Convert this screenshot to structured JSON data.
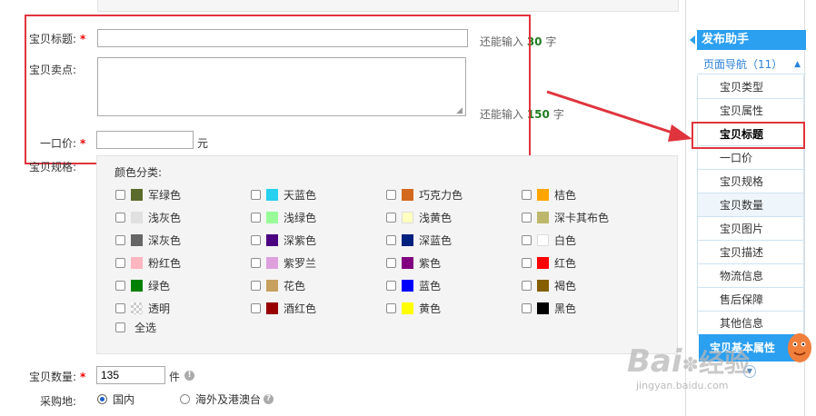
{
  "form": {
    "title_label": "宝贝标题:",
    "title_required": "*",
    "title_value": "",
    "title_hint_prefix": "还能输入 ",
    "title_hint_count": "30",
    "title_hint_suffix": " 字",
    "selling_label": "宝贝卖点:",
    "selling_value": "",
    "selling_hint_prefix": "还能输入 ",
    "selling_hint_count": "150",
    "selling_hint_suffix": " 字",
    "price_label": "一口价:",
    "price_required": "*",
    "price_value": "",
    "price_unit": "元",
    "spec_label": "宝贝规格:",
    "color_category_label": "颜色分类:",
    "quantity_label": "宝贝数量:",
    "quantity_required": "*",
    "quantity_value": "135",
    "quantity_unit": "件",
    "purchase_label": "采购地:",
    "purchase_options": [
      "国内",
      "海外及港澳台"
    ]
  },
  "colors": [
    {
      "label": "军绿色",
      "swatch": "#5b6b2c"
    },
    {
      "label": "天蓝色",
      "swatch": "#26d0ee"
    },
    {
      "label": "巧克力色",
      "swatch": "#d2691e"
    },
    {
      "label": "桔色",
      "swatch": "#ffa500"
    },
    {
      "label": "浅灰色",
      "swatch": "#e0e0e0"
    },
    {
      "label": "浅绿色",
      "swatch": "#98fb98"
    },
    {
      "label": "浅黄色",
      "swatch": "#ffffc0"
    },
    {
      "label": "深卡其布色",
      "swatch": "#bdb76b"
    },
    {
      "label": "深灰色",
      "swatch": "#666666"
    },
    {
      "label": "深紫色",
      "swatch": "#4b0082"
    },
    {
      "label": "深蓝色",
      "swatch": "#00207f"
    },
    {
      "label": "白色",
      "swatch": "#ffffff"
    },
    {
      "label": "粉红色",
      "swatch": "#ffb6c1"
    },
    {
      "label": "紫罗兰",
      "swatch": "#dda0dd"
    },
    {
      "label": "紫色",
      "swatch": "#800080"
    },
    {
      "label": "红色",
      "swatch": "#ff0000"
    },
    {
      "label": "绿色",
      "swatch": "#008000"
    },
    {
      "label": "花色",
      "swatch": "#c8a060"
    },
    {
      "label": "蓝色",
      "swatch": "#0000ff"
    },
    {
      "label": "褐色",
      "swatch": "#855e00"
    },
    {
      "label": "透明",
      "swatch": "transparent"
    },
    {
      "label": "酒红色",
      "swatch": "#990000"
    },
    {
      "label": "黄色",
      "swatch": "#ffff00"
    },
    {
      "label": "黑色",
      "swatch": "#000000"
    }
  ],
  "select_all_label": "全选",
  "sidebar": {
    "header": "发布助手",
    "subheader": "页面导航（11）",
    "items": [
      "宝贝类型",
      "宝贝属性",
      "宝贝标题",
      "一口价",
      "宝贝规格",
      "宝贝数量",
      "宝贝图片",
      "宝贝描述",
      "物流信息",
      "售后保障",
      "其他信息"
    ],
    "active_index": 2,
    "bottom_button": "宝贝基本属性"
  },
  "watermark": {
    "brand": "Bai",
    "brand2": "经验",
    "url": "jingyan.baidu.com"
  },
  "theme": {
    "accent": "#2b9ff0",
    "highlight_red": "#e0343d",
    "hint_green": "#1e7e1e"
  }
}
